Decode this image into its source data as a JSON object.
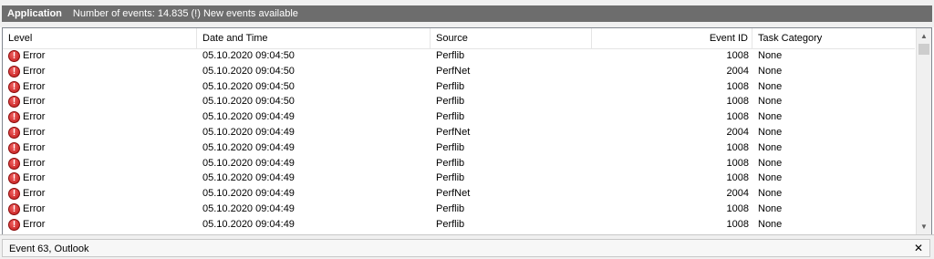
{
  "header": {
    "log_name": "Application",
    "info": "Number of events: 14.835 (!) New events available"
  },
  "table": {
    "columns": [
      "Level",
      "Date and Time",
      "Source",
      "Event ID",
      "Task Category"
    ],
    "rows": [
      {
        "level": "Error",
        "datetime": "05.10.2020 09:04:50",
        "source": "Perflib",
        "event_id": "1008",
        "category": "None"
      },
      {
        "level": "Error",
        "datetime": "05.10.2020 09:04:50",
        "source": "PerfNet",
        "event_id": "2004",
        "category": "None"
      },
      {
        "level": "Error",
        "datetime": "05.10.2020 09:04:50",
        "source": "Perflib",
        "event_id": "1008",
        "category": "None"
      },
      {
        "level": "Error",
        "datetime": "05.10.2020 09:04:50",
        "source": "Perflib",
        "event_id": "1008",
        "category": "None"
      },
      {
        "level": "Error",
        "datetime": "05.10.2020 09:04:49",
        "source": "Perflib",
        "event_id": "1008",
        "category": "None"
      },
      {
        "level": "Error",
        "datetime": "05.10.2020 09:04:49",
        "source": "PerfNet",
        "event_id": "2004",
        "category": "None"
      },
      {
        "level": "Error",
        "datetime": "05.10.2020 09:04:49",
        "source": "Perflib",
        "event_id": "1008",
        "category": "None"
      },
      {
        "level": "Error",
        "datetime": "05.10.2020 09:04:49",
        "source": "Perflib",
        "event_id": "1008",
        "category": "None"
      },
      {
        "level": "Error",
        "datetime": "05.10.2020 09:04:49",
        "source": "Perflib",
        "event_id": "1008",
        "category": "None"
      },
      {
        "level": "Error",
        "datetime": "05.10.2020 09:04:49",
        "source": "PerfNet",
        "event_id": "2004",
        "category": "None"
      },
      {
        "level": "Error",
        "datetime": "05.10.2020 09:04:49",
        "source": "Perflib",
        "event_id": "1008",
        "category": "None"
      },
      {
        "level": "Error",
        "datetime": "05.10.2020 09:04:49",
        "source": "Perflib",
        "event_id": "1008",
        "category": "None"
      }
    ],
    "row_icon": "error-icon"
  },
  "scrollbar": {
    "up_icon": "chevron-up-icon",
    "down_icon": "chevron-down-icon"
  },
  "detail_pane": {
    "title": "Event 63, Outlook",
    "close_icon": "close-icon",
    "close_glyph": "✕"
  },
  "colors": {
    "header_band": "#6d6d6d",
    "error_red": "#c01818"
  }
}
